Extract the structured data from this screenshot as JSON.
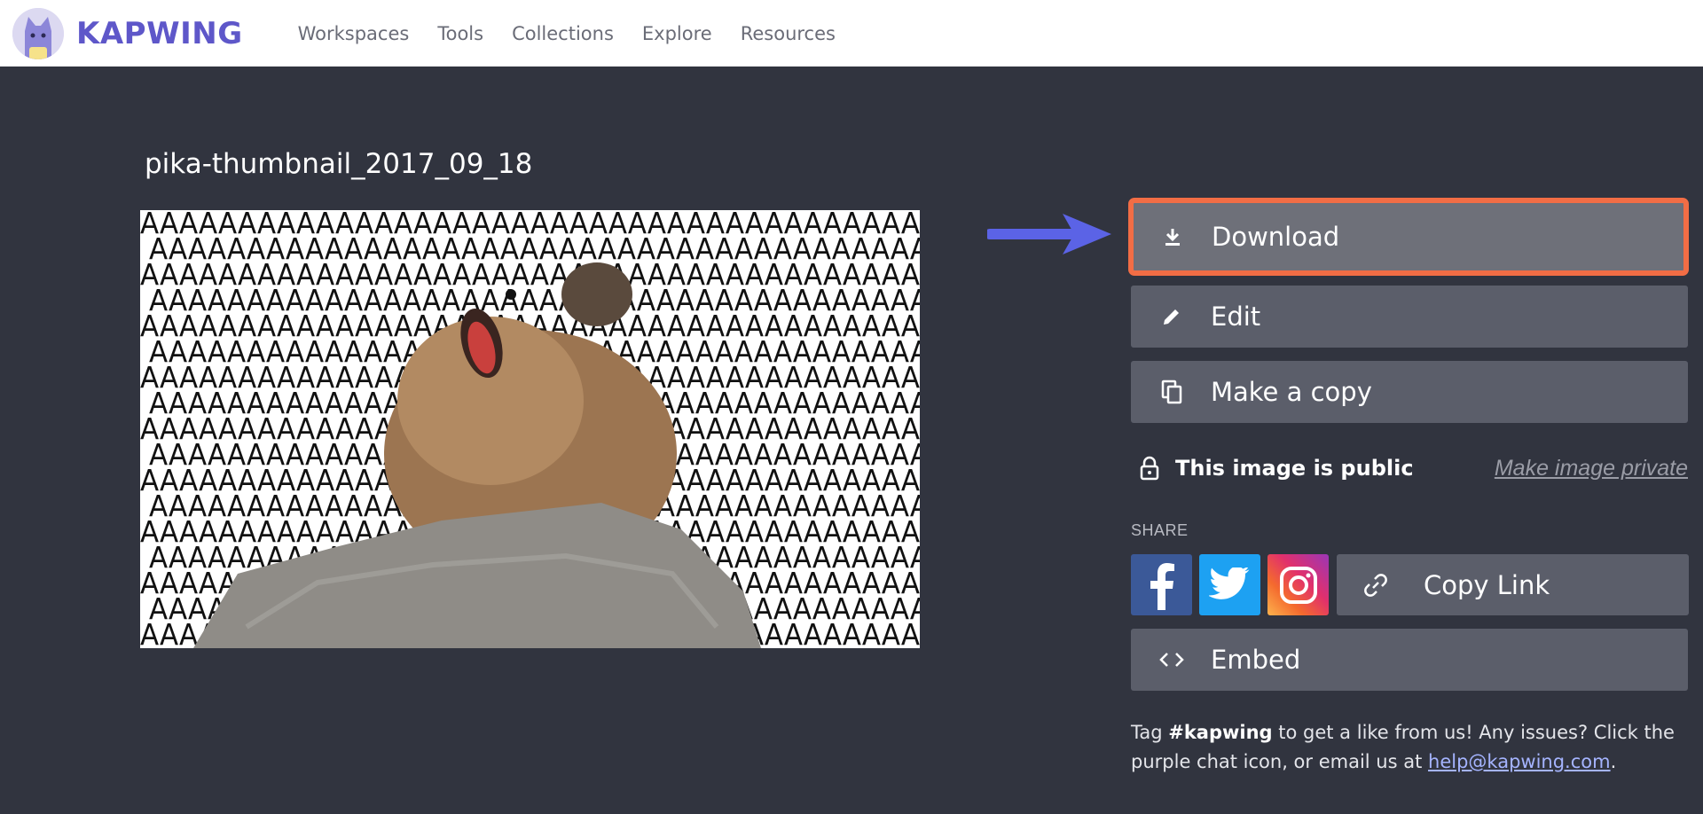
{
  "header": {
    "brand": "KAPWING",
    "nav": [
      "Workspaces",
      "Tools",
      "Collections",
      "Explore",
      "Resources"
    ]
  },
  "page": {
    "title": "pika-thumbnail_2017_09_18",
    "image_pattern_text": "AAAAAAAAAAAAAAAAAAAAAAAAAAAAAAAAAAAAAAAA"
  },
  "actions": {
    "download": "Download",
    "edit": "Edit",
    "copy": "Make a copy",
    "embed": "Embed"
  },
  "privacy": {
    "status": "This image is public",
    "toggle": "Make image private"
  },
  "share": {
    "heading": "SHARE",
    "copy_link": "Copy Link"
  },
  "footer": {
    "prefix": "Tag ",
    "hashtag": "#kapwing",
    "middle": " to get a like from us! Any issues? Click the purple chat icon, or email us at ",
    "email": "help@kapwing.com",
    "suffix": "."
  },
  "colors": {
    "background": "#31343f",
    "button": "#5b5e6a",
    "highlight_outline": "#f26d45",
    "arrow": "#5b63e6",
    "brand": "#5e57c9"
  },
  "icons": {
    "download": "download-icon",
    "edit": "pencil-icon",
    "copy": "copy-icon",
    "embed": "code-brackets-icon",
    "lock": "lock-icon",
    "link": "link-icon"
  }
}
